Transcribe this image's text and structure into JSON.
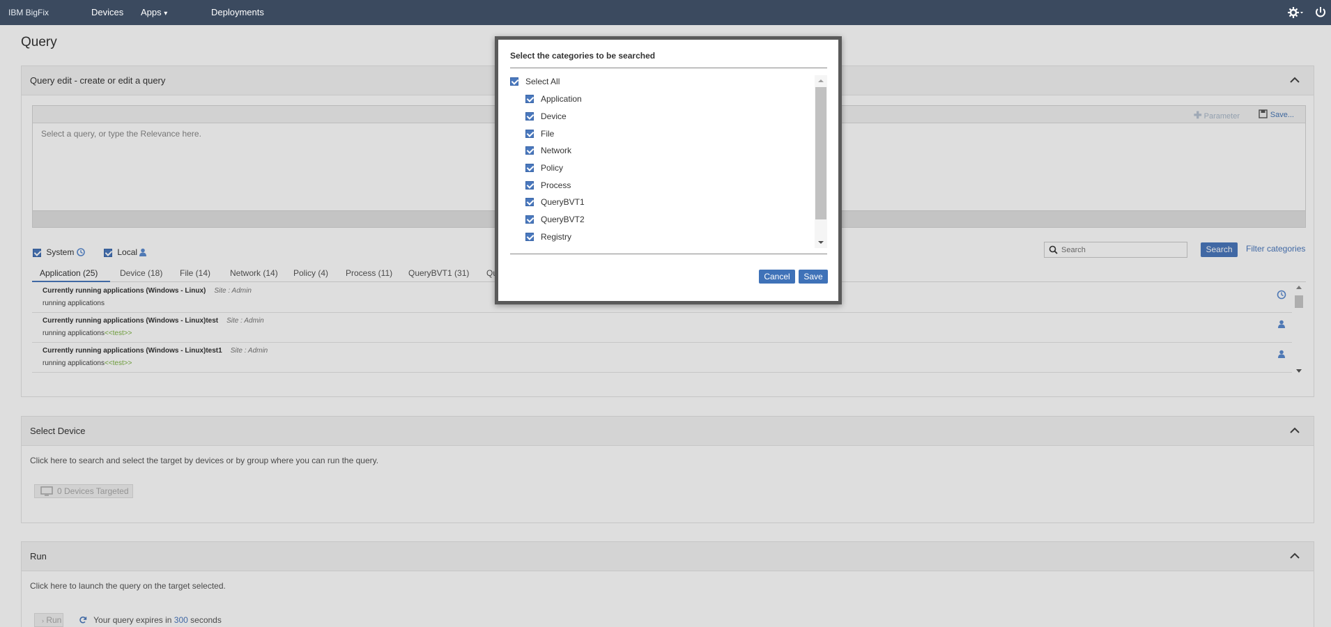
{
  "nav": {
    "brand": "IBM BigFix",
    "items": [
      "Devices",
      "Apps",
      "Deployments"
    ],
    "apps_caret": "▾"
  },
  "page": {
    "title": "Query"
  },
  "query_edit": {
    "title": "Query edit - create or edit a query",
    "toolbar_parameter": "Parameter",
    "toolbar_save": "Save...",
    "placeholder": "Select a query, or type the Relevance here.",
    "filter_system": "System",
    "filter_local": "Local",
    "search_placeholder": "Search",
    "search_button": "Search",
    "filter_categories": "Filter categories",
    "tabs": [
      "Application (25)",
      "Device (18)",
      "File (14)",
      "Network (14)",
      "Policy (4)",
      "Process (11)",
      "QueryBVT1 (31)",
      "Qu"
    ],
    "queries": [
      {
        "title": "Currently running applications (Windows - Linux)",
        "site": "Site : Admin",
        "desc": "running applications",
        "param": "",
        "icon": "system-icon"
      },
      {
        "title": "Currently running applications (Windows - Linux)test",
        "site": "Site : Admin",
        "desc": "running applications",
        "param": "<<test>>",
        "icon": "user-icon"
      },
      {
        "title": "Currently running applications (Windows - Linux)test1",
        "site": "Site : Admin",
        "desc": "running applications",
        "param": "<<test>>",
        "icon": "user-icon"
      }
    ]
  },
  "select_device": {
    "title": "Select Device",
    "instructions": "Click here to search and select the target by devices or by group where you can run the query.",
    "devices_targeted": "0 Devices Targeted"
  },
  "run": {
    "title": "Run",
    "instructions": "Click here to launch the query on the target selected.",
    "run_button": "Run",
    "expires_prefix": "Your query expires in",
    "expires_value": "300",
    "expires_suffix": "seconds"
  },
  "dialog": {
    "title": "Select the categories to be searched",
    "select_all": "Select All",
    "categories": [
      "Application",
      "Device",
      "File",
      "Network",
      "Policy",
      "Process",
      "QueryBVT1",
      "QueryBVT2",
      "Registry"
    ],
    "cancel": "Cancel",
    "save": "Save"
  },
  "colors": {
    "nav_bg": "#3b4a5f",
    "accent": "#4a78bd",
    "param_green": "#7cb342"
  }
}
